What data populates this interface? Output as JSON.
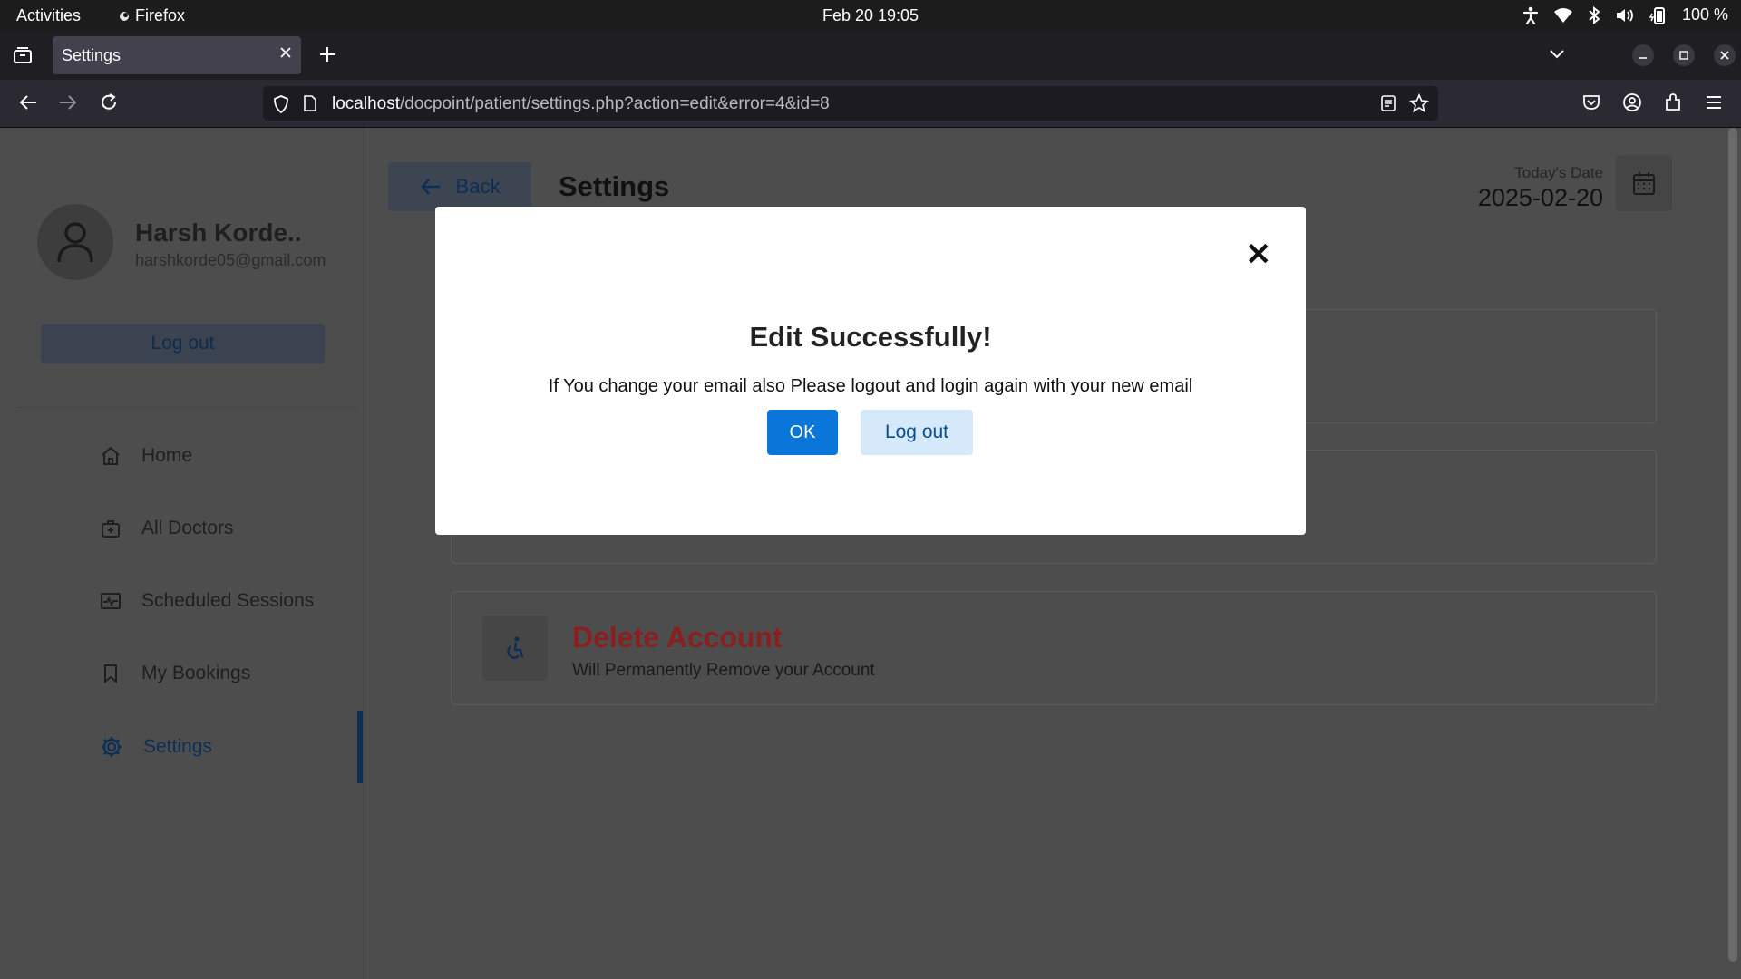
{
  "system_bar": {
    "activities": "Activities",
    "app_name": "Firefox",
    "clock": "Feb 20  19:05",
    "battery": "100 %"
  },
  "browser": {
    "tab_title": "Settings",
    "url_host": "localhost",
    "url_path": "/docpoint/patient/settings.php?action=edit&error=4&id=8"
  },
  "sidebar": {
    "user_name": "Harsh Korde..",
    "user_email": "harshkorde05@gmail.com",
    "logout_label": "Log out",
    "items": [
      {
        "label": "Home",
        "icon": "home-icon"
      },
      {
        "label": "All Doctors",
        "icon": "doctor-bag-icon"
      },
      {
        "label": "Scheduled Sessions",
        "icon": "sessions-icon"
      },
      {
        "label": "My Bookings",
        "icon": "bookmark-icon"
      },
      {
        "label": "Settings",
        "icon": "gear-icon",
        "active": true
      }
    ]
  },
  "header": {
    "back_label": "Back",
    "title": "Settings",
    "date_label": "Today's Date",
    "date_value": "2025-02-20"
  },
  "cards": {
    "delete_title": "Delete Account",
    "delete_subtitle": "Will Permanently Remove your Account"
  },
  "modal": {
    "title": "Edit Successfully!",
    "message": "If You change your email also Please logout and login again with your new email",
    "ok_label": "OK",
    "logout_label": "Log out",
    "close_glyph": "✕"
  },
  "colors": {
    "accent": "#0a76d9",
    "danger": "#8a1f1f",
    "overlay_page": "#4d4d4d"
  }
}
